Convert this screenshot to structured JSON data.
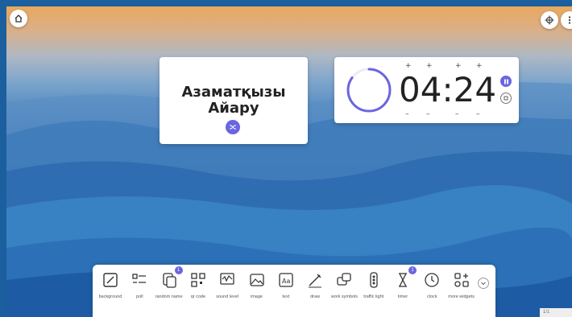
{
  "top_bar": {
    "home_icon": "home-icon",
    "move_icon": "move-crosshair-icon",
    "menu_icon": "more-vertical-icon"
  },
  "name_widget": {
    "line1": "Азаматқызы",
    "line2": "Айару",
    "shuffle_icon": "shuffle-icon"
  },
  "timer_widget": {
    "time": "04:24",
    "plus": "+",
    "minus": "–",
    "ring_progress": 0.85,
    "pause_icon": "pause-icon",
    "stop_icon": "stop-icon"
  },
  "toolbar": {
    "items": [
      {
        "label": "background",
        "icon": "background-icon"
      },
      {
        "label": "poll",
        "icon": "poll-icon"
      },
      {
        "label": "random name",
        "icon": "random-name-icon",
        "badge": "1"
      },
      {
        "label": "qr code",
        "icon": "qr-code-icon"
      },
      {
        "label": "sound level",
        "icon": "sound-level-icon"
      },
      {
        "label": "image",
        "icon": "image-icon"
      },
      {
        "label": "text",
        "icon": "text-icon"
      },
      {
        "label": "draw",
        "icon": "draw-icon"
      },
      {
        "label": "work symbols",
        "icon": "work-symbols-icon"
      },
      {
        "label": "traffic light",
        "icon": "traffic-light-icon"
      },
      {
        "label": "timer",
        "icon": "timer-icon",
        "badge": "1"
      },
      {
        "label": "clock",
        "icon": "clock-icon"
      },
      {
        "label": "more widgets",
        "icon": "more-widgets-icon"
      }
    ],
    "collapse_icon": "chevron-down-icon"
  },
  "pager": {
    "text": "1/1"
  },
  "colors": {
    "accent": "#6a65e0",
    "card": "#ffffff"
  }
}
